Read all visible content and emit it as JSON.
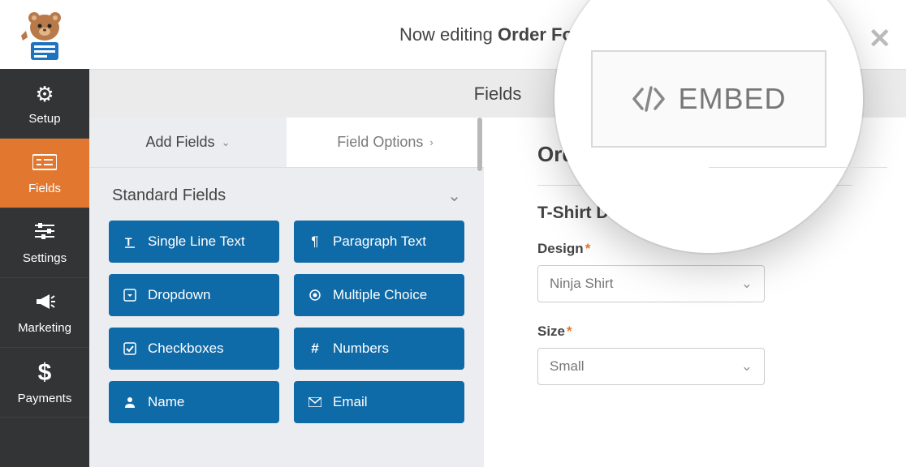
{
  "header": {
    "editing_prefix": "Now editing ",
    "editing_title": "Order Form",
    "close_icon": "✕"
  },
  "sidebar": {
    "items": [
      {
        "label": "Setup"
      },
      {
        "label": "Fields"
      },
      {
        "label": "Settings"
      },
      {
        "label": "Marketing"
      },
      {
        "label": "Payments"
      }
    ]
  },
  "section_header": "Fields",
  "tabs": {
    "add": "Add Fields",
    "options": "Field Options"
  },
  "fields_section": {
    "title": "Standard Fields",
    "items": [
      {
        "label": "Single Line Text"
      },
      {
        "label": "Paragraph Text"
      },
      {
        "label": "Dropdown"
      },
      {
        "label": "Multiple Choice"
      },
      {
        "label": "Checkboxes"
      },
      {
        "label": "Numbers"
      },
      {
        "label": "Name"
      },
      {
        "label": "Email"
      }
    ]
  },
  "preview": {
    "title_partial": "Orde",
    "section_title": "T-Shirt Details",
    "design_label": "Design",
    "design_value": "Ninja Shirt",
    "size_label": "Size",
    "size_value": "Small",
    "required_mark": "*"
  },
  "embed_label": "EMBED"
}
